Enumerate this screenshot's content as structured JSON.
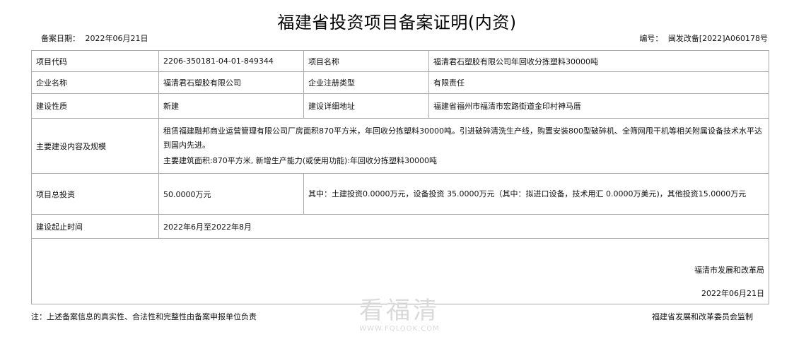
{
  "document": {
    "title": "福建省投资项目备案证明(内资)",
    "record_date_label": "备案日期：",
    "record_date": "2022年06月21日",
    "number_label": "编号：",
    "number": "闽发改备[2022]A060178号"
  },
  "table": {
    "project_code_label": "项目代码",
    "project_code": "2206-350181-04-01-849344",
    "project_name_label": "项目名称",
    "project_name": "福清君石塑胶有限公司年回收分拣塑料30000吨",
    "company_name_label": "企业名称",
    "company_name": "福清君石塑胶有限公司",
    "company_type_label": "企业注册类型",
    "company_type": "有限责任",
    "nature_label": "建设性质",
    "nature": "新建",
    "address_label": "建设详细地址",
    "address": "福建省福州市福清市宏路街道金印村神马厝",
    "scope_label": "主要建设内容及规模",
    "scope_text": "租赁福建融邦商业运营管理有限公司厂房面积870平方米，年回收分拣塑料30000吨。引进破碎清洗生产线，购置安装800型破碎机、全筛网甩干机等相关附属设备技术水平达到国内先进。",
    "scope_capacity": "主要建筑面积:870平方米, 新增生产能力(或使用功能):年回收分拣塑料30000吨",
    "investment_label": "项目总投资",
    "investment_total": "50.0000万元",
    "investment_detail": "其中：土建投资0.0000万元，设备投资 35.0000万元（其中：拟进口设备，技术用汇 0.0000万美元)，其他投资15.0000万元",
    "period_label": "建设起止时间",
    "period": "2022年6月至2022年8月",
    "sign_org": "福清市发展和改革局",
    "sign_date": "2022年06月21日"
  },
  "footer": {
    "note": "注：上述备案信息的真实性、合法性和完整性由备案申报单位负责",
    "supervisor": "福建省发展和改革委员会监制"
  },
  "watermark": {
    "text": "看福清",
    "url": "WWW.FQLOOK.COM"
  }
}
